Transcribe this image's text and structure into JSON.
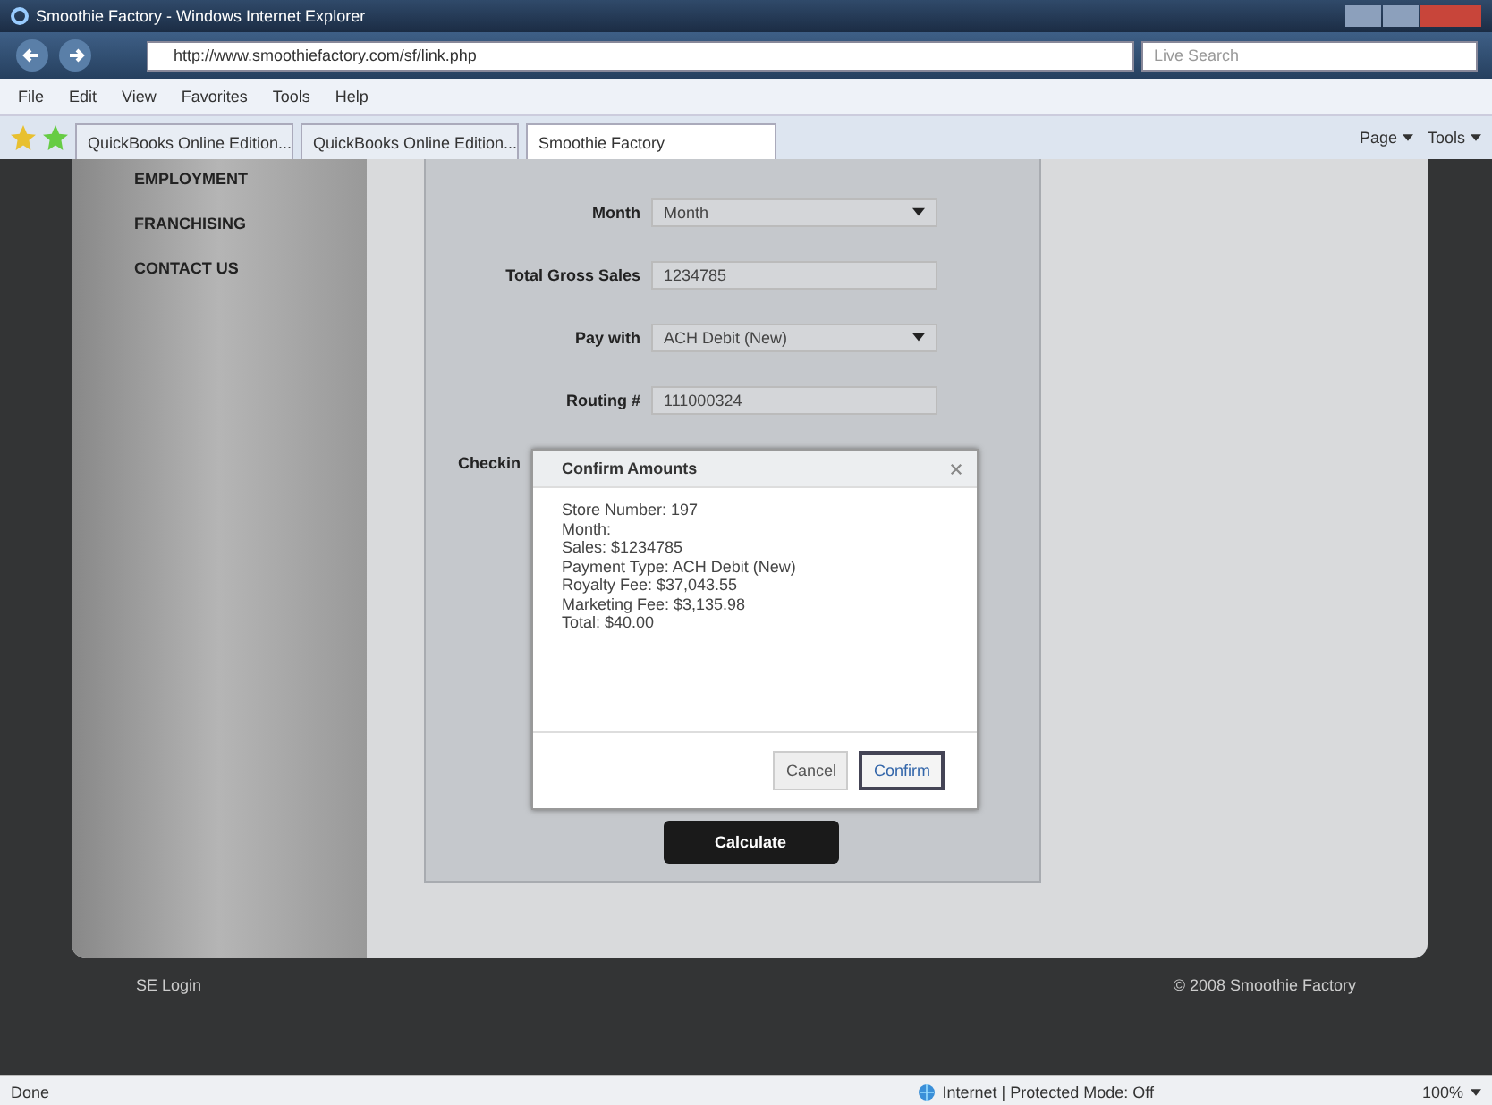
{
  "window": {
    "title": "Smoothie Factory - Windows Internet Explorer"
  },
  "address_bar": {
    "url": "http://www.smoothiefactory.com/sf/link.php",
    "search_placeholder": "Live Search"
  },
  "menu": [
    "File",
    "Edit",
    "View",
    "Favorites",
    "Tools",
    "Help"
  ],
  "tabs": [
    {
      "label": "QuickBooks Online Edition...",
      "selected": false
    },
    {
      "label": "QuickBooks Online Edition...",
      "selected": false
    },
    {
      "label": "Smoothie Factory",
      "selected": true
    }
  ],
  "command_bar": [
    "Page",
    "Tools"
  ],
  "sidebar": {
    "items": [
      "EMPLOYMENT",
      "FRANCHISING",
      "CONTACT US"
    ]
  },
  "form": {
    "fields": [
      {
        "label": "Month",
        "kind": "select",
        "value": "Month"
      },
      {
        "label": "Total Gross Sales",
        "kind": "text",
        "value": "1234785"
      },
      {
        "label": "Pay with",
        "kind": "select",
        "value": "ACH Debit (New)"
      },
      {
        "label": "Routing #",
        "kind": "text",
        "value": "111000324"
      }
    ],
    "partial_label": "Checkin",
    "button": "Calculate"
  },
  "dialog": {
    "title": "Confirm Amounts",
    "lines": [
      "Store Number: 197",
      "Month:",
      "Sales: $1234785",
      "Payment Type: ACH Debit (New)",
      "Royalty Fee: $37,043.55",
      "Marketing Fee: $3,135.98",
      "Total: $40.00"
    ],
    "buttons": [
      {
        "label": "Cancel",
        "focused": false
      },
      {
        "label": "Confirm",
        "focused": true
      }
    ]
  },
  "footer": {
    "left": "SE Login",
    "right": "© 2008 Smoothie Factory"
  },
  "status_bar": {
    "left": "Done",
    "zone": "Internet | Protected Mode: Off",
    "zoom": "100%"
  }
}
